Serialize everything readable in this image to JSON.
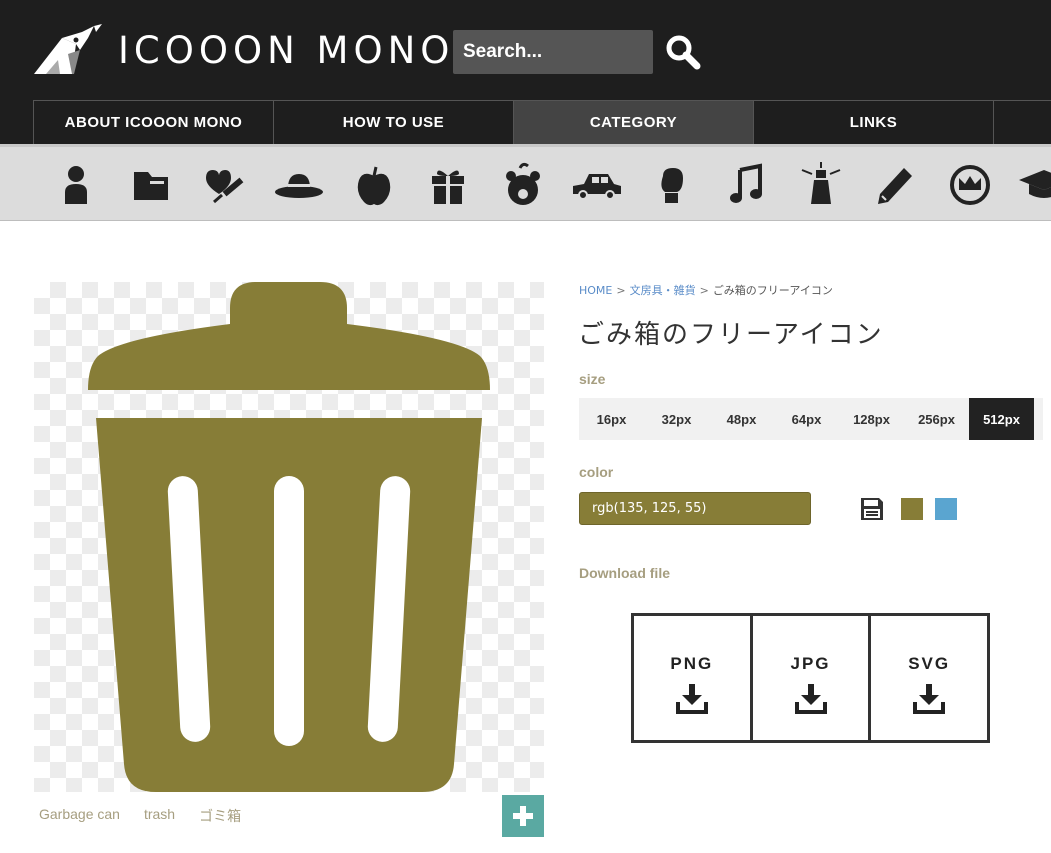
{
  "header": {
    "logo_text": "ICOOON MONO",
    "search_placeholder": "Search..."
  },
  "nav": {
    "items": [
      {
        "label": "ABOUT ICOOON MONO"
      },
      {
        "label": "HOW TO USE"
      },
      {
        "label": "CATEGORY"
      },
      {
        "label": "LINKS"
      }
    ],
    "active": "CATEGORY"
  },
  "category_icons": [
    "person-icon",
    "folder-icon",
    "medical-icon",
    "hat-icon",
    "apple-icon",
    "gift-icon",
    "bear-icon",
    "car-icon",
    "boxing-glove-icon",
    "music-note-icon",
    "lighthouse-icon",
    "pencil-icon",
    "crown-icon",
    "graduation-cap-icon"
  ],
  "tags": [
    "Garbage can",
    "trash",
    "ゴミ箱"
  ],
  "breadcrumb": {
    "home": "HOME",
    "category": "文房具・雑貨",
    "current": "ごみ箱のフリーアイコン",
    "separator": ">"
  },
  "title": "ごみ箱のフリーアイコン",
  "size": {
    "label": "size",
    "options": [
      "16px",
      "32px",
      "48px",
      "64px",
      "128px",
      "256px",
      "512px"
    ],
    "selected": "512px"
  },
  "color": {
    "label": "color",
    "value": "rgb(135, 125, 55)",
    "swatches": [
      "#877d37",
      "#5aa5d0"
    ]
  },
  "download": {
    "label": "Download file",
    "formats": [
      "PNG",
      "JPG",
      "SVG"
    ]
  },
  "colors": {
    "icon": "#877d37",
    "header_bg": "#1e1e1e",
    "accent_teal": "#5aa9a2"
  }
}
